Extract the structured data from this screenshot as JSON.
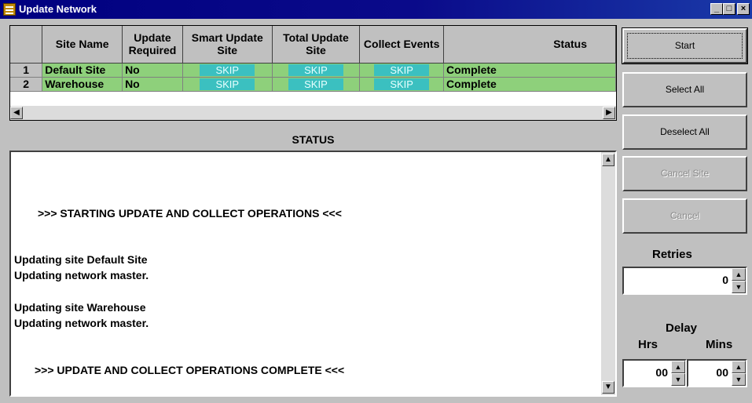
{
  "window": {
    "title": "Update Network"
  },
  "grid": {
    "headers": {
      "site_name": "Site Name",
      "update_required": "Update Required",
      "smart_update": "Smart Update Site",
      "total_update": "Total Update Site",
      "collect_events": "Collect Events",
      "status": "Status"
    },
    "rows": [
      {
        "num": "1",
        "site": "Default Site",
        "update": "No",
        "smart": "SKIP",
        "total": "SKIP",
        "collect": "SKIP",
        "status": "Complete"
      },
      {
        "num": "2",
        "site": "Warehouse",
        "update": "No",
        "smart": "SKIP",
        "total": "SKIP",
        "collect": "SKIP",
        "status": "Complete"
      }
    ]
  },
  "status": {
    "heading": "STATUS",
    "lines": [
      ">>> STARTING UPDATE AND COLLECT OPERATIONS <<<",
      "Updating site Default Site",
      "Updating network master.",
      "Updating site Warehouse",
      "Updating network master.",
      ">>> UPDATE AND COLLECT OPERATIONS COMPLETE <<<"
    ]
  },
  "buttons": {
    "start": "Start",
    "select_all": "Select All",
    "deselect_all": "Deselect All",
    "cancel_site": "Cancel Site",
    "cancel": "Cancel"
  },
  "retries": {
    "label": "Retries",
    "value": "0"
  },
  "delay": {
    "label": "Delay",
    "hrs_label": "Hrs",
    "mins_label": "Mins",
    "hrs_value": "00",
    "mins_value": "00"
  },
  "colors": {
    "titlebar": "#000080",
    "row_ok": "#8ed07b",
    "skip": "#3bc0c0"
  }
}
